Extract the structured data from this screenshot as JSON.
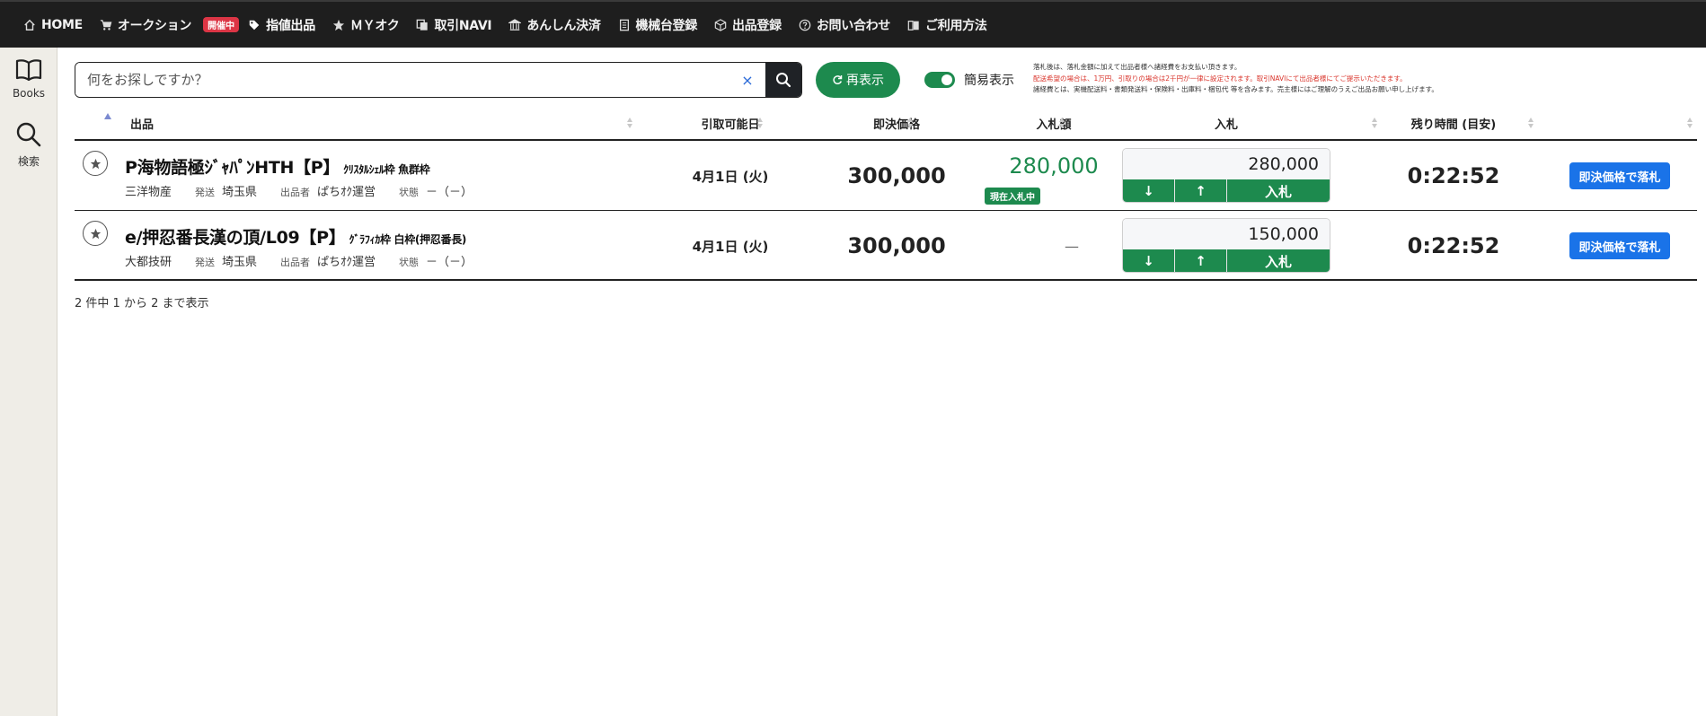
{
  "nav": {
    "items": [
      {
        "label": "HOME",
        "icon": "home-icon"
      },
      {
        "label": "オークション",
        "icon": "cart-icon"
      },
      {
        "label": "指値出品",
        "icon": "tag-icon"
      },
      {
        "label": "ＭＹオク",
        "icon": "star-icon"
      },
      {
        "label": "取引NAVI",
        "icon": "copy-icon"
      },
      {
        "label": "あんしん決済",
        "icon": "bank-icon"
      },
      {
        "label": "機械台登録",
        "icon": "document-icon"
      },
      {
        "label": "出品登録",
        "icon": "box-icon"
      },
      {
        "label": "お問い合わせ",
        "icon": "question-icon"
      },
      {
        "label": "ご利用方法",
        "icon": "book-icon"
      }
    ],
    "badge": "開催中"
  },
  "sidebar": {
    "books_label": "Books",
    "search_label": "検索"
  },
  "search": {
    "placeholder": "何をお探しですか？",
    "clear": "×"
  },
  "refresh_label": "再表示",
  "toggle_label": "簡易表示",
  "notice": {
    "line1": "落札後は、落札金額に加えて出品者様へ諸経費をお支払い頂きます。",
    "line2": "配送希望の場合は、1万円、引取りの場合は2千円が一律に設定されます。取引NAVIにて出品者様にてご提示いただきます。",
    "line3": "諸経費とは、実機配送料・書類発送料・保険料・出庫料・梱包代 等を含みます。売主様にはご理解のうえご出品お願い申し上げます。"
  },
  "table": {
    "headers": {
      "item": "出品",
      "date": "引取可能日",
      "price": "即決価格",
      "bid_amount": "入札額",
      "bid": "入札",
      "time_left": "残り時間 (目安)"
    },
    "rows": [
      {
        "title": "P海物語極ｼﾞｬﾊﾟﾝHTH【P】",
        "subtitle": "ｸﾘｽﾀﾙｼｪﾙ枠 魚群枠",
        "maker": "三洋物産",
        "ship_label": "発送",
        "ship": "埼玉県",
        "seller_label": "出品者",
        "seller": "ぱちｵｸ運営",
        "status_label": "状態",
        "status": "－（－）",
        "date": "4月1日 (火)",
        "price": "300,000",
        "bid_amount": "280,000",
        "bid_badge": "現在入札中",
        "bid_input": "280,000",
        "down": "↓",
        "up": "↑",
        "submit": "入札",
        "time_left": "0:22:52",
        "buy_now": "即決価格で落札"
      },
      {
        "title": "e/押忍番長漢の頂/L09【P】",
        "subtitle": "ｸﾞﾗﾌｨｶ枠 白枠(押忍番長)",
        "maker": "大都技研",
        "ship_label": "発送",
        "ship": "埼玉県",
        "seller_label": "出品者",
        "seller": "ぱちｵｸ運営",
        "status_label": "状態",
        "status": "－（－）",
        "date": "4月1日 (火)",
        "price": "300,000",
        "bid_amount": "—",
        "bid_input": "150,000",
        "down": "↓",
        "up": "↑",
        "submit": "入札",
        "time_left": "0:22:52",
        "buy_now": "即決価格で落札"
      }
    ]
  },
  "footer": "2 件中 1 から 2 まで表示",
  "colors": {
    "nav_bg": "#1e1e1e",
    "green": "#1d8a4e",
    "blue": "#1a73e8",
    "badge_red": "#dc3545",
    "sidebar_bg": "#efede7"
  }
}
